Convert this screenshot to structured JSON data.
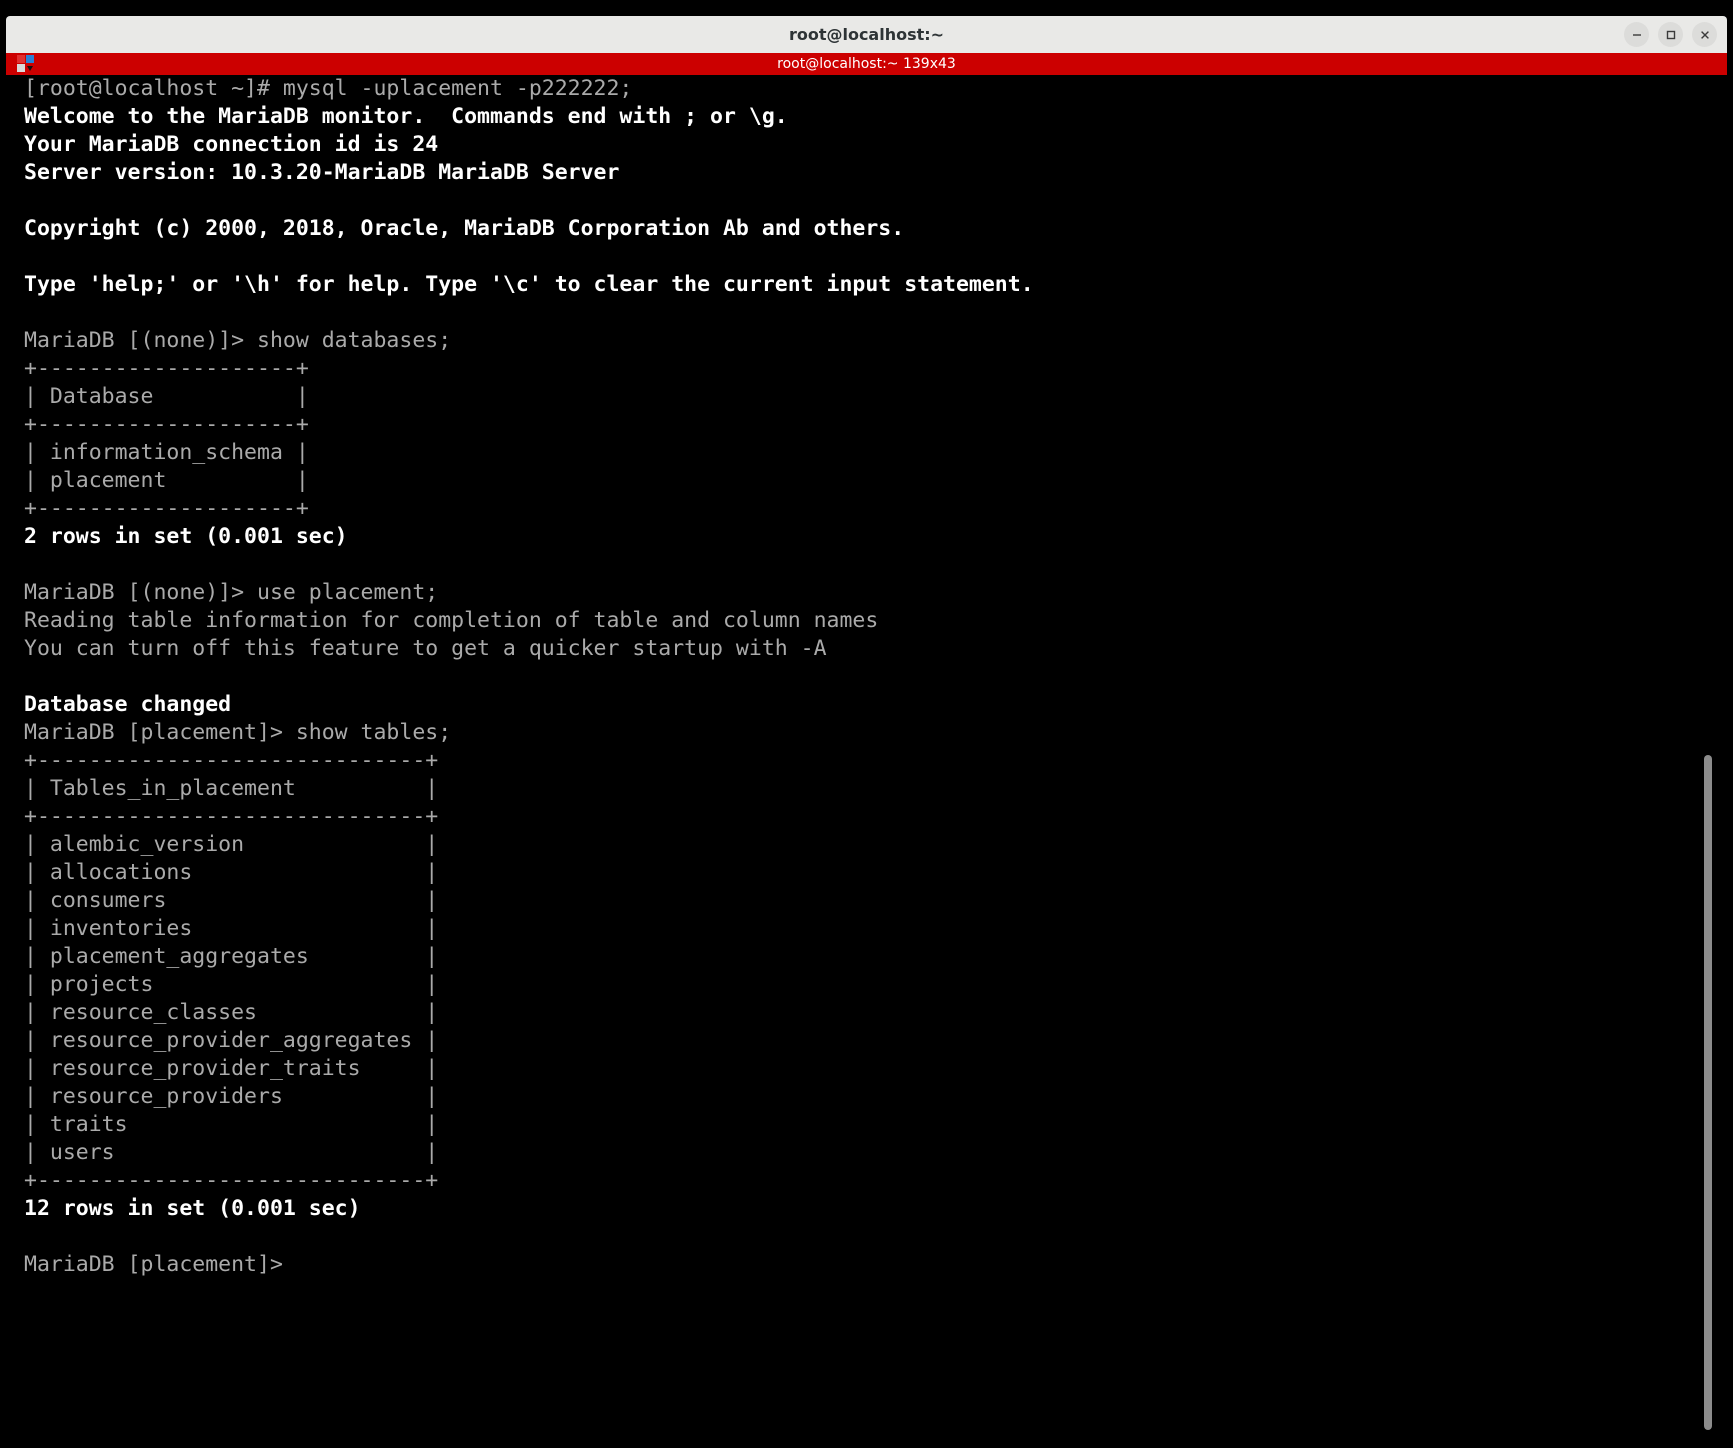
{
  "window": {
    "title": "root@localhost:~",
    "controls": [
      {
        "name": "minimize",
        "glyph": "—"
      },
      {
        "name": "maximize",
        "glyph": "□"
      },
      {
        "name": "close",
        "glyph": "×"
      }
    ]
  },
  "tabbar": {
    "tab_label": "root@localhost:~ 139x43",
    "menu_icon": "terminal-menu-icon",
    "background": "#cc0000"
  },
  "terminal": {
    "background": "#000000",
    "dim_color": "#aaaaaa",
    "bold_color": "#ffffff",
    "lines": [
      {
        "text": "[root@localhost ~]# mysql -uplacement -p222222;",
        "style": "dim"
      },
      {
        "text": "Welcome to the MariaDB monitor.  Commands end with ; or \\g.",
        "style": "bold"
      },
      {
        "text": "Your MariaDB connection id is 24",
        "style": "bold"
      },
      {
        "text": "Server version: 10.3.20-MariaDB MariaDB Server",
        "style": "bold"
      },
      {
        "text": "",
        "style": "dim"
      },
      {
        "text": "Copyright (c) 2000, 2018, Oracle, MariaDB Corporation Ab and others.",
        "style": "bold"
      },
      {
        "text": "",
        "style": "dim"
      },
      {
        "text": "Type 'help;' or '\\h' for help. Type '\\c' to clear the current input statement.",
        "style": "bold"
      },
      {
        "text": "",
        "style": "dim"
      },
      {
        "text": "MariaDB [(none)]> show databases;",
        "style": "dim"
      },
      {
        "text": "+--------------------+",
        "style": "dim"
      },
      {
        "text": "| Database           |",
        "style": "dim"
      },
      {
        "text": "+--------------------+",
        "style": "dim"
      },
      {
        "text": "| information_schema |",
        "style": "dim"
      },
      {
        "text": "| placement          |",
        "style": "dim"
      },
      {
        "text": "+--------------------+",
        "style": "dim"
      },
      {
        "text": "2 rows in set (0.001 sec)",
        "style": "bold"
      },
      {
        "text": "",
        "style": "dim"
      },
      {
        "text": "MariaDB [(none)]> use placement;",
        "style": "dim"
      },
      {
        "text": "Reading table information for completion of table and column names",
        "style": "dim"
      },
      {
        "text": "You can turn off this feature to get a quicker startup with -A",
        "style": "dim"
      },
      {
        "text": "",
        "style": "dim"
      },
      {
        "text": "Database changed",
        "style": "bold"
      },
      {
        "text": "MariaDB [placement]> show tables;",
        "style": "dim"
      },
      {
        "text": "+------------------------------+",
        "style": "dim"
      },
      {
        "text": "| Tables_in_placement          |",
        "style": "dim"
      },
      {
        "text": "+------------------------------+",
        "style": "dim"
      },
      {
        "text": "| alembic_version              |",
        "style": "dim"
      },
      {
        "text": "| allocations                  |",
        "style": "dim"
      },
      {
        "text": "| consumers                    |",
        "style": "dim"
      },
      {
        "text": "| inventories                  |",
        "style": "dim"
      },
      {
        "text": "| placement_aggregates         |",
        "style": "dim"
      },
      {
        "text": "| projects                     |",
        "style": "dim"
      },
      {
        "text": "| resource_classes             |",
        "style": "dim"
      },
      {
        "text": "| resource_provider_aggregates |",
        "style": "dim"
      },
      {
        "text": "| resource_provider_traits     |",
        "style": "dim"
      },
      {
        "text": "| resource_providers           |",
        "style": "dim"
      },
      {
        "text": "| traits                       |",
        "style": "dim"
      },
      {
        "text": "| users                        |",
        "style": "dim"
      },
      {
        "text": "+------------------------------+",
        "style": "dim"
      },
      {
        "text": "12 rows in set (0.001 sec)",
        "style": "bold"
      },
      {
        "text": "",
        "style": "dim"
      },
      {
        "text": "MariaDB [placement]>",
        "style": "dim"
      }
    ],
    "databases": {
      "header": "Database",
      "rows": [
        "information_schema",
        "placement"
      ],
      "row_count_text": "2 rows in set (0.001 sec)"
    },
    "tables": {
      "header": "Tables_in_placement",
      "rows": [
        "alembic_version",
        "allocations",
        "consumers",
        "inventories",
        "placement_aggregates",
        "projects",
        "resource_classes",
        "resource_provider_aggregates",
        "resource_provider_traits",
        "resource_providers",
        "traits",
        "users"
      ],
      "row_count_text": "12 rows in set (0.001 sec)"
    },
    "prompt": "MariaDB [placement]>"
  }
}
